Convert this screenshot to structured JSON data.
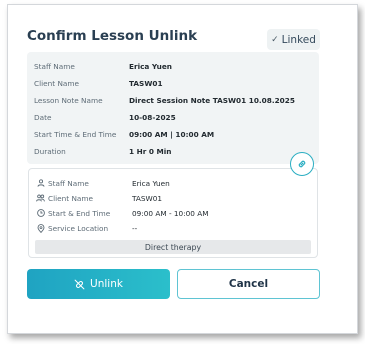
{
  "dialog": {
    "title": "Confirm Lesson Unlink",
    "status_badge": "Linked"
  },
  "lesson_note": {
    "rows": [
      {
        "label": "Staff Name",
        "value": "Erica Yuen"
      },
      {
        "label": "Client Name",
        "value": "TASW01"
      },
      {
        "label": "Lesson Note Name",
        "value": "Direct Session Note TASW01 10.08.2025"
      },
      {
        "label": "Date",
        "value": "10-08-2025"
      },
      {
        "label": "Start Time & End Time",
        "value": "09:00 AM | 10:00 AM"
      },
      {
        "label": "Duration",
        "value": "1 Hr 0 Min"
      }
    ]
  },
  "session": {
    "rows": [
      {
        "icon": "person-icon",
        "label": "Staff Name",
        "value": "Erica Yuen"
      },
      {
        "icon": "group-icon",
        "label": "Client Name",
        "value": "TASW01"
      },
      {
        "icon": "clock-icon",
        "label": "Start & End Time",
        "value": "09:00 AM - 10:00 AM"
      },
      {
        "icon": "location-pin-icon",
        "label": "Service Location",
        "value": "--"
      }
    ],
    "service_type": "Direct therapy"
  },
  "actions": {
    "unlink_label": "Unlink",
    "cancel_label": "Cancel"
  },
  "colors": {
    "accent": "#2bbfcb",
    "title": "#2a3f52"
  }
}
